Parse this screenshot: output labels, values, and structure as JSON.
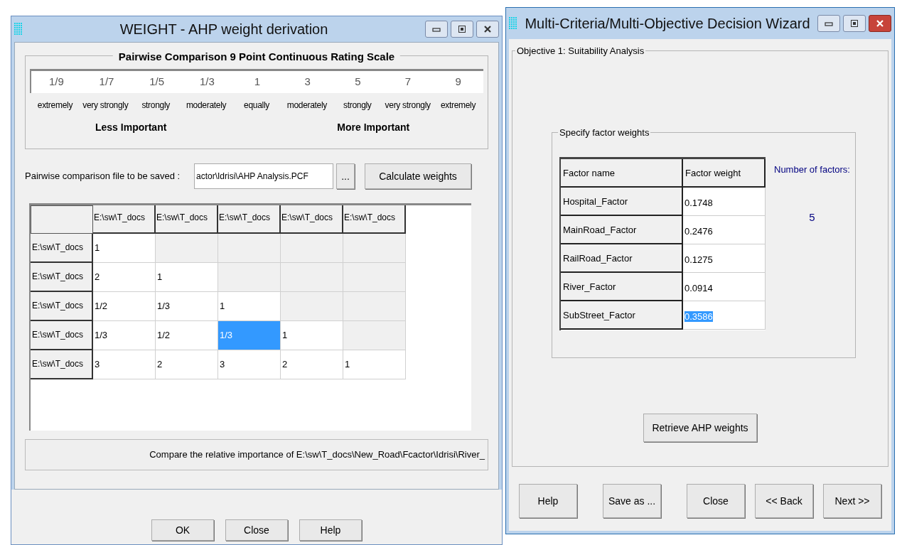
{
  "weight_window": {
    "title": "WEIGHT - AHP weight derivation",
    "scale_group": {
      "title": "Pairwise Comparison 9 Point Continuous Rating Scale",
      "points": [
        {
          "value": "1/9",
          "label": "extremely"
        },
        {
          "value": "1/7",
          "label": "very strongly"
        },
        {
          "value": "1/5",
          "label": "strongly"
        },
        {
          "value": "1/3",
          "label": "moderately"
        },
        {
          "value": "1",
          "label": "equally"
        },
        {
          "value": "3",
          "label": "moderately"
        },
        {
          "value": "5",
          "label": "strongly"
        },
        {
          "value": "7",
          "label": "very strongly"
        },
        {
          "value": "9",
          "label": "extremely"
        }
      ],
      "less_label": "Less Important",
      "more_label": "More Important"
    },
    "file_label": "Pairwise comparison file to be saved :",
    "file_value": "actor\\Idrisi\\AHP Analysis.PCF",
    "browse_button": "...",
    "calculate_button": "Calculate weights",
    "matrix": {
      "columns": [
        "E:\\sw\\T_docs",
        "E:\\sw\\T_docs",
        "E:\\sw\\T_docs",
        "E:\\sw\\T_docs",
        "E:\\sw\\T_docs"
      ],
      "rows": [
        {
          "header": "E:\\sw\\T_docs",
          "cells": [
            {
              "value": "1",
              "selected": false
            }
          ]
        },
        {
          "header": "E:\\sw\\T_docs",
          "cells": [
            {
              "value": "2",
              "selected": false
            },
            {
              "value": "1",
              "selected": false
            }
          ]
        },
        {
          "header": "E:\\sw\\T_docs",
          "cells": [
            {
              "value": "1/2",
              "selected": false
            },
            {
              "value": "1/3",
              "selected": false
            },
            {
              "value": "1",
              "selected": false
            }
          ]
        },
        {
          "header": "E:\\sw\\T_docs",
          "cells": [
            {
              "value": "1/3",
              "selected": false
            },
            {
              "value": "1/2",
              "selected": false
            },
            {
              "value": "1/3",
              "selected": true
            },
            {
              "value": "1",
              "selected": false
            }
          ]
        },
        {
          "header": "E:\\sw\\T_docs",
          "cells": [
            {
              "value": "3",
              "selected": false
            },
            {
              "value": "2",
              "selected": false
            },
            {
              "value": "3",
              "selected": false
            },
            {
              "value": "2",
              "selected": false
            },
            {
              "value": "1",
              "selected": false
            }
          ]
        }
      ]
    },
    "status": "Compare the relative importance of E:\\sw\\T_docs\\New_Road\\Fcactor\\Idrisi\\River_",
    "buttons": [
      "OK",
      "Close",
      "Help"
    ]
  },
  "wizard_window": {
    "title": "Multi-Criteria/Multi-Objective Decision Wizard",
    "objective_group": "Objective 1: Suitability Analysis",
    "factor_group": "Specify factor weights",
    "table": {
      "columns": [
        "Factor name",
        "Factor weight"
      ],
      "rows": [
        {
          "name": "Hospital_Factor",
          "weight": "0.1748",
          "selected": false
        },
        {
          "name": "MainRoad_Factor",
          "weight": "0.2476",
          "selected": false
        },
        {
          "name": "RailRoad_Factor",
          "weight": "0.1275",
          "selected": false
        },
        {
          "name": "River_Factor",
          "weight": "0.0914",
          "selected": false
        },
        {
          "name": "SubStreet_Factor",
          "weight": "0.3586",
          "selected": true
        }
      ]
    },
    "count_label": "Number of factors:",
    "count_value": "5",
    "retrieve_button": "Retrieve AHP weights",
    "buttons": [
      "Help",
      "Save as ...",
      "Close",
      "<< Back",
      "Next >>"
    ]
  }
}
